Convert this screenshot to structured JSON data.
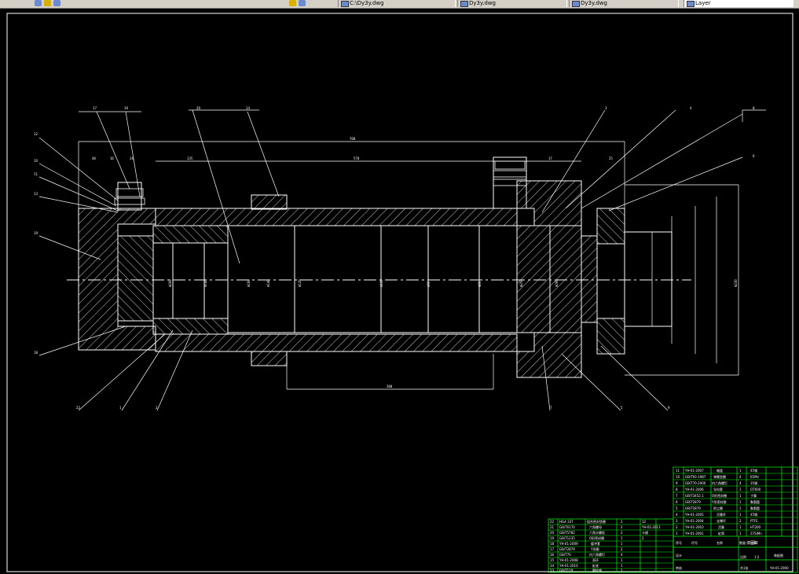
{
  "toolbar": {
    "tabs": [
      {
        "label": "C:\\Dy3y.dwg",
        "icon": "drawing-file-icon"
      },
      {
        "label": "Dy3y.dwg",
        "icon": "drawing-file-icon"
      },
      {
        "label": "Dy3y.dwg",
        "icon": "drawing-file-icon"
      },
      {
        "label": "Layer",
        "icon": "layer-icon"
      }
    ]
  },
  "drawing": {
    "colors": {
      "background": "#000000",
      "lines": "#ffffff",
      "frame": "#00ff00",
      "hatch": "#ffffff",
      "title": "#00ff00"
    },
    "dimensions": {
      "overall": "700",
      "inner": "570",
      "left1": "48",
      "left2": "16",
      "left3": "24",
      "left4": "135",
      "right1": "17",
      "right2": "25",
      "stroke": "300",
      "diam1": "Φ200",
      "diam2": "Φ180",
      "diam3": "Φ160",
      "diam4": "Φ140",
      "diam5": "Φ120",
      "diam6": "Φ100",
      "diam7": "Φ90",
      "diam8": "Φ80",
      "diam9": "Φ250",
      "diam10": "Φ280",
      "diam11": "Φ230"
    },
    "balloons": [
      "17",
      "16",
      "20",
      "14",
      "12",
      "10",
      "11",
      "13",
      "19",
      "18",
      "22",
      "1",
      "2",
      "3",
      "4",
      "8",
      "6",
      "7",
      "5",
      "9",
      "15",
      "21"
    ],
    "bom_right": [
      {
        "no": "11",
        "code": "YH-01-2007",
        "name": "端盖",
        "qty": "1",
        "mat": "45钢"
      },
      {
        "no": "10",
        "code": "GB/T93-1987",
        "name": "弹簧垫圈",
        "qty": "4",
        "mat": "65Mn"
      },
      {
        "no": "9",
        "code": "GB/T70-2000",
        "name": "内六角螺钉",
        "qty": "4",
        "mat": "35钢"
      },
      {
        "no": "8",
        "code": "YH-01-2006",
        "name": "导向套",
        "qty": "1",
        "mat": "QT600"
      },
      {
        "no": "7",
        "code": "GB/T3452.1",
        "name": "O形密封圈",
        "qty": "1",
        "mat": "丁腈"
      },
      {
        "no": "6",
        "code": "GB/T2879",
        "name": "Y形密封圈",
        "qty": "1",
        "mat": "聚氨酯"
      },
      {
        "no": "5",
        "code": "GB/T2879",
        "name": "防尘圈",
        "qty": "1",
        "mat": "聚氨酯"
      },
      {
        "no": "4",
        "code": "YH-01-2005",
        "name": "活塞杆",
        "qty": "1",
        "mat": "45钢"
      },
      {
        "no": "3",
        "code": "YH-01-2004",
        "name": "支撑环",
        "qty": "2",
        "mat": "PTFE"
      },
      {
        "no": "2",
        "code": "YH-01-2003",
        "name": "活塞",
        "qty": "1",
        "mat": "HT200"
      },
      {
        "no": "1",
        "code": "YH-01-2001",
        "name": "缸筒",
        "qty": "1",
        "mat": "27SiMn"
      }
    ],
    "bom_left": [
      {
        "no": "22",
        "code": "HG4-337",
        "name": "组合密封垫圈",
        "qty": "2"
      },
      {
        "no": "21",
        "code": "GB/T6170",
        "name": "六角螺母",
        "qty": "2"
      },
      {
        "no": "20",
        "code": "GB/T5782",
        "name": "六角头螺栓",
        "qty": "2"
      },
      {
        "no": "19",
        "code": "GB/T1235",
        "name": "O形密封圈",
        "qty": "1"
      },
      {
        "no": "18",
        "code": "YH-01-2009",
        "name": "缓冲套",
        "qty": "1"
      },
      {
        "no": "17",
        "code": "GB/T2879",
        "name": "Y形圈",
        "qty": "2"
      },
      {
        "no": "16",
        "code": "GB/T70",
        "name": "内六角螺钉",
        "qty": "4"
      },
      {
        "no": "15",
        "code": "YH-01-2008",
        "name": "耳环",
        "qty": "1"
      },
      {
        "no": "14",
        "code": "YH-01-2010",
        "name": "缸底",
        "qty": "1"
      },
      {
        "no": "13",
        "code": "GB/T119",
        "name": "圆柱销",
        "qty": "1"
      },
      {
        "no": "12",
        "code": "YH-01-2011",
        "name": "卡键",
        "qty": "2"
      }
    ],
    "title_block": {
      "header_no": "序号",
      "header_code": "代号",
      "header_name": "名称",
      "header_qty": "数量",
      "header_mat": "材料",
      "drawing_title": "液压缸",
      "drawing_number": "YH-01-2000",
      "scale_label": "比例",
      "scale": "1:2",
      "sheet": "共1张",
      "designer": "设计",
      "checker": "审核",
      "school": "装配图"
    }
  }
}
